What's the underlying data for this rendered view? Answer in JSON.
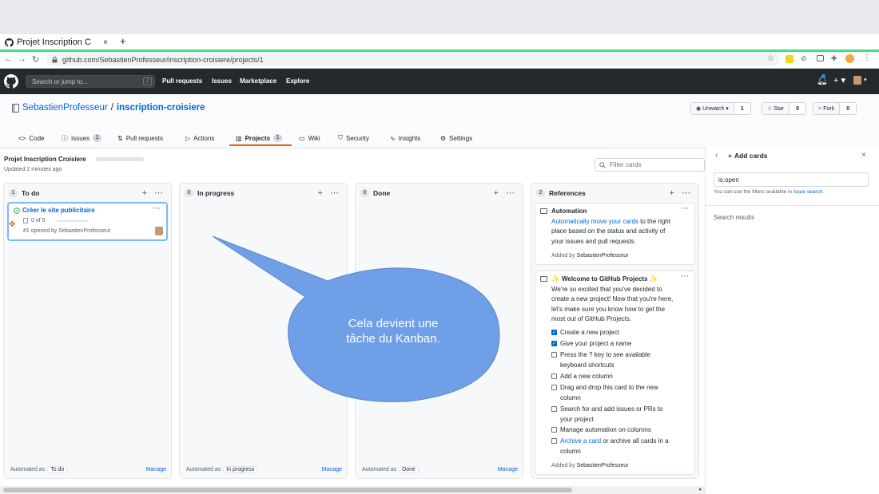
{
  "browser": {
    "tab_title": "Projet Inscription C",
    "tab_close": "×",
    "new_tab": "+",
    "url": "github.com/SebastienProfesseur/inscription-croisiere/projects/1"
  },
  "github_header": {
    "search_placeholder": "Search or jump to...",
    "search_key": "/",
    "nav": [
      "Pull requests",
      "Issues",
      "Marketplace",
      "Explore"
    ]
  },
  "repo": {
    "owner": "SebastienProfesseur",
    "separator": "/",
    "name": "inscription-croisiere",
    "unwatch_label": "Unwatch",
    "unwatch_count": "1",
    "star_label": "Star",
    "star_count": "0",
    "fork_label": "Fork",
    "fork_count": "0",
    "tabs": [
      {
        "label": "Code",
        "count": ""
      },
      {
        "label": "Issues",
        "count": "1"
      },
      {
        "label": "Pull requests",
        "count": ""
      },
      {
        "label": "Actions",
        "count": ""
      },
      {
        "label": "Projects",
        "count": "1"
      },
      {
        "label": "Wiki",
        "count": ""
      },
      {
        "label": "Security",
        "count": ""
      },
      {
        "label": "Insights",
        "count": ""
      },
      {
        "label": "Settings",
        "count": ""
      }
    ]
  },
  "project": {
    "title": "Projet Inscription Croisiere",
    "updated": "Updated 2 minutes ago",
    "filter_placeholder": "Filter cards",
    "manage_label": "Manage",
    "automated_as": "Automated as",
    "columns": [
      {
        "count": "1",
        "name": "To do",
        "automation": "To do"
      },
      {
        "count": "0",
        "name": "In progress",
        "automation": "In progress"
      },
      {
        "count": "0",
        "name": "Done",
        "automation": "Done"
      },
      {
        "count": "2",
        "name": "References",
        "automation": ""
      }
    ]
  },
  "issue_card": {
    "title": "Créer le site publicitaire",
    "progress": "0 of 5",
    "progress_fraction": 0,
    "meta": "#1 opened by SebastienProfesseur"
  },
  "automation_note": {
    "title": "Automation",
    "link_text": "Automatically move your cards",
    "body": " to the right place based on the status and activity of your issues and pull requests.",
    "added_by_label": "Added by",
    "added_by": "SebastienProfesseur"
  },
  "welcome_note": {
    "title": "Welcome to GitHub Projects",
    "intro": "We're so excited that you've decided to create a new project! Now that you're here, let's make sure you know how to get the most out of GitHub Projects.",
    "checklist": [
      {
        "text": "Create a new project",
        "checked": true
      },
      {
        "text": "Give your project a name",
        "checked": true
      },
      {
        "text": "Press the ? key to see available keyboard shortcuts",
        "checked": false
      },
      {
        "text": "Add a new column",
        "checked": false
      },
      {
        "text": "Drag and drop this card to the new column",
        "checked": false
      },
      {
        "text": "Search for and add issues or PRs to your project",
        "checked": false
      },
      {
        "text": "Manage automation on columns",
        "checked": false
      },
      {
        "text": "Archive a card or archive all cards in a column",
        "checked": false
      }
    ],
    "archive_link": "Archive a card",
    "added_by_label": "Added by",
    "added_by": "SebastienProfesseur"
  },
  "side_panel": {
    "title": "Add cards",
    "search_value": "is:open",
    "hint": "You can use the filters available in ",
    "hint_link": "issue search",
    "hint_end": ".",
    "results_label": "Search results"
  },
  "callout": {
    "line1": "Cela devient une",
    "line2": "tâche du Kanban."
  },
  "colors": {
    "callout_fill": "#6f9fe6",
    "header_bg": "#24292e",
    "tab_accent": "#e36209",
    "link": "#0366d6"
  }
}
